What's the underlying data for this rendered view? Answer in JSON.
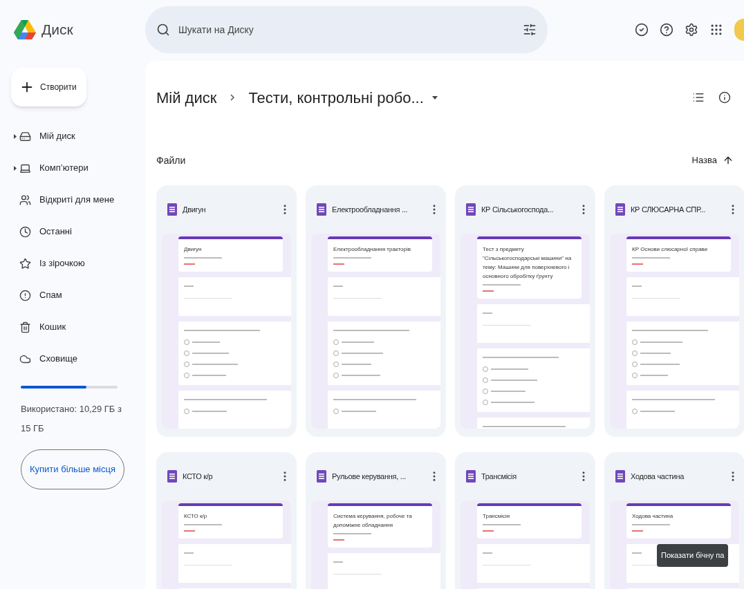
{
  "header": {
    "app_name": "Диск",
    "search": {
      "placeholder": "Шукати на Диску"
    }
  },
  "new_button": "Створити",
  "sidebar": {
    "items": [
      {
        "label": "Мій диск",
        "expandable": true
      },
      {
        "label": "Комп’ютери",
        "expandable": true
      },
      {
        "label": "Відкриті для мене",
        "expandable": false
      },
      {
        "label": "Останні",
        "expandable": false
      },
      {
        "label": "Із зірочкою",
        "expandable": false
      },
      {
        "label": "Спам",
        "expandable": false
      },
      {
        "label": "Кошик",
        "expandable": false
      },
      {
        "label": "Сховище",
        "expandable": false
      }
    ]
  },
  "storage": {
    "level": 0.68,
    "text": "Використано: 10,29 ГБ з 15 ГБ"
  },
  "buy_button": "Купити більше місця",
  "breadcrumb": [
    "Мій диск",
    "Тести, контрольні робо..."
  ],
  "section_title": "Файли",
  "sort": {
    "label": "Назва"
  },
  "files": [
    {
      "name": "Двигун",
      "preview_title": "Двигун"
    },
    {
      "name": "Електрообладнання ...",
      "preview_title": "Електрообладнання тракторів"
    },
    {
      "name": "КР Сільськогоспода...",
      "preview_title": "Тест з предмету \"Сільськогосподарські машини\" на тему: Машини для поверхневого і основного обробітку ґрунту"
    },
    {
      "name": "КР СЛЮСАРНА СПР...",
      "preview_title": "КР Основи слюсарної справи"
    },
    {
      "name": "КСТО к/р",
      "preview_title": "КСТО к/р"
    },
    {
      "name": "Рульове керування, ...",
      "preview_title": "Система керування, робоче та допоміжне обладнання"
    },
    {
      "name": "Трансмісія",
      "preview_title": "Трансмісія"
    },
    {
      "name": "Ходова частина",
      "preview_title": "Ходова частина"
    }
  ],
  "tooltip": "Показати бічну па"
}
